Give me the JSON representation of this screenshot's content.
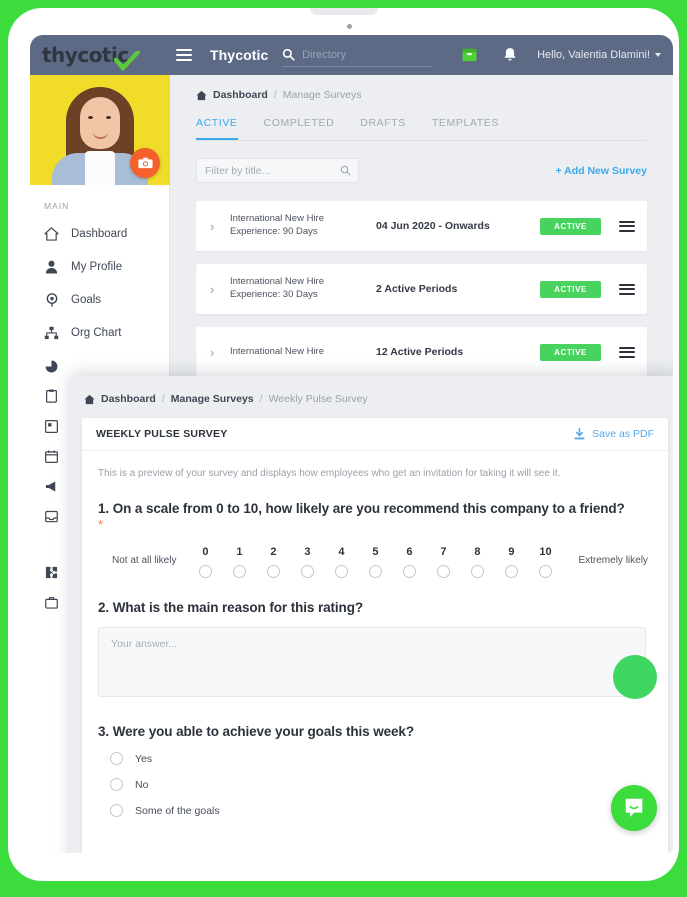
{
  "topbar": {
    "brand": "thycotic",
    "brand_check_icon": "green-check-icon",
    "menu_icon": "hamburger-icon",
    "app_title": "Thycotic",
    "search_icon": "search-icon",
    "search_placeholder": "Directory",
    "search_value": "",
    "inbox_icon": "inbox-icon",
    "bell_icon": "bell-icon",
    "greeting": "Hello, Valentia Dlamini!",
    "caret_icon": "chevron-down-icon",
    "bg_color": "#5d6a86",
    "accent_green": "#3ddc3d"
  },
  "sidebar": {
    "camera_icon": "camera-icon",
    "section_label": "MAIN",
    "items": [
      {
        "label": "Dashboard",
        "icon": "home-icon"
      },
      {
        "label": "My Profile",
        "icon": "user-icon"
      },
      {
        "label": "Goals",
        "icon": "target-icon"
      },
      {
        "label": "Org Chart",
        "icon": "org-chart-icon"
      }
    ],
    "hidden_icons": [
      "pie-chart-icon",
      "clipboard-icon",
      "grid-icon",
      "calendar-icon",
      "megaphone-icon",
      "inbox-tray-icon",
      "puzzle-icon",
      "briefcase-icon"
    ]
  },
  "main": {
    "breadcrumb": {
      "home_icon": "home-icon",
      "items": [
        "Dashboard",
        "Manage Surveys"
      ],
      "separator": "/"
    },
    "tabs": [
      {
        "label": "ACTIVE",
        "active": true
      },
      {
        "label": "COMPLETED",
        "active": false
      },
      {
        "label": "DRAFTS",
        "active": false
      },
      {
        "label": "TEMPLATES",
        "active": false
      }
    ],
    "filter": {
      "placeholder": "Filter by title...",
      "value": "",
      "icon": "search-icon"
    },
    "add_new_survey_label": "+ Add New Survey",
    "surveys": [
      {
        "chevron_icon": "chevron-right-icon",
        "title": "International New Hire Experience: 90 Days",
        "period": "04 Jun 2020 - Onwards",
        "status": "ACTIVE",
        "menu_icon": "list-menu-icon"
      },
      {
        "chevron_icon": "chevron-right-icon",
        "title": "International New Hire Experience: 30 Days",
        "period": "2 Active Periods",
        "status": "ACTIVE",
        "menu_icon": "list-menu-icon"
      },
      {
        "chevron_icon": "chevron-right-icon",
        "title": "International New Hire",
        "period": "12 Active Periods",
        "status": "ACTIVE",
        "menu_icon": "list-menu-icon"
      }
    ],
    "status_color": "#47d35d",
    "accent_blue": "#3ba8ea"
  },
  "modal": {
    "breadcrumb": {
      "home_icon": "home-icon",
      "items": [
        "Dashboard",
        "Manage Surveys"
      ],
      "current": "Weekly Pulse Survey",
      "separator": "/"
    },
    "survey_title": "WEEKLY PULSE SURVEY",
    "save_pdf_label": "Save as PDF",
    "download_icon": "download-icon",
    "description": "This is a preview of your survey and displays how employees who get an invitation for taking it will see it.",
    "questions": [
      {
        "number": "1.",
        "text": "1. On a scale from 0 to 10, how likely are you recommend this company to a friend?",
        "required_marker": "*",
        "type": "nps",
        "low_label": "Not at all likely",
        "high_label": "Extremely likely",
        "scale": [
          "0",
          "1",
          "2",
          "3",
          "4",
          "5",
          "6",
          "7",
          "8",
          "9",
          "10"
        ]
      },
      {
        "number": "2.",
        "text": "2. What is the main reason for this rating?",
        "type": "textarea",
        "placeholder": "Your answer...",
        "value": ""
      },
      {
        "number": "3.",
        "text": "3. Were you able to achieve your goals this week?",
        "type": "radio",
        "options": [
          "Yes",
          "No",
          "Some of the goals"
        ]
      }
    ]
  },
  "chat": {
    "icon": "chat-bubble-icon",
    "color": "#3ddc3d"
  }
}
